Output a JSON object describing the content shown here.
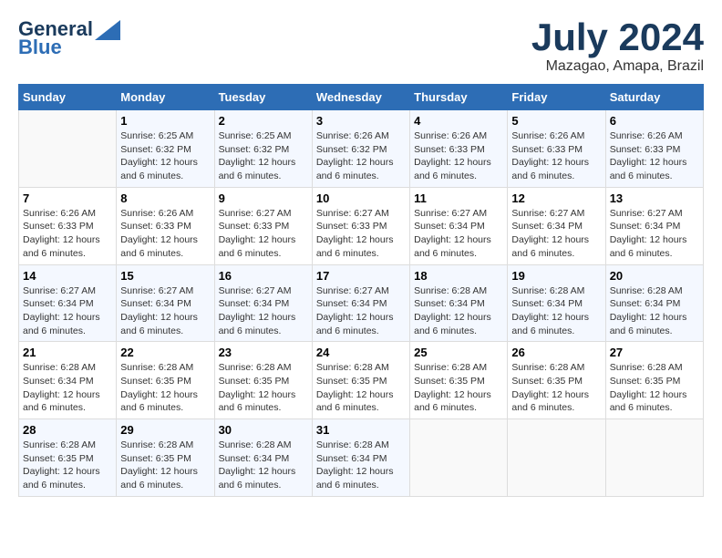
{
  "header": {
    "logo_line1": "General",
    "logo_line2": "Blue",
    "month": "July 2024",
    "location": "Mazagao, Amapa, Brazil"
  },
  "days_of_week": [
    "Sunday",
    "Monday",
    "Tuesday",
    "Wednesday",
    "Thursday",
    "Friday",
    "Saturday"
  ],
  "weeks": [
    [
      {
        "day": "",
        "info": ""
      },
      {
        "day": "1",
        "info": "Sunrise: 6:25 AM\nSunset: 6:32 PM\nDaylight: 12 hours\nand 6 minutes."
      },
      {
        "day": "2",
        "info": "Sunrise: 6:25 AM\nSunset: 6:32 PM\nDaylight: 12 hours\nand 6 minutes."
      },
      {
        "day": "3",
        "info": "Sunrise: 6:26 AM\nSunset: 6:32 PM\nDaylight: 12 hours\nand 6 minutes."
      },
      {
        "day": "4",
        "info": "Sunrise: 6:26 AM\nSunset: 6:33 PM\nDaylight: 12 hours\nand 6 minutes."
      },
      {
        "day": "5",
        "info": "Sunrise: 6:26 AM\nSunset: 6:33 PM\nDaylight: 12 hours\nand 6 minutes."
      },
      {
        "day": "6",
        "info": "Sunrise: 6:26 AM\nSunset: 6:33 PM\nDaylight: 12 hours\nand 6 minutes."
      }
    ],
    [
      {
        "day": "7",
        "info": "Sunrise: 6:26 AM\nSunset: 6:33 PM\nDaylight: 12 hours\nand 6 minutes."
      },
      {
        "day": "8",
        "info": "Sunrise: 6:26 AM\nSunset: 6:33 PM\nDaylight: 12 hours\nand 6 minutes."
      },
      {
        "day": "9",
        "info": "Sunrise: 6:27 AM\nSunset: 6:33 PM\nDaylight: 12 hours\nand 6 minutes."
      },
      {
        "day": "10",
        "info": "Sunrise: 6:27 AM\nSunset: 6:33 PM\nDaylight: 12 hours\nand 6 minutes."
      },
      {
        "day": "11",
        "info": "Sunrise: 6:27 AM\nSunset: 6:34 PM\nDaylight: 12 hours\nand 6 minutes."
      },
      {
        "day": "12",
        "info": "Sunrise: 6:27 AM\nSunset: 6:34 PM\nDaylight: 12 hours\nand 6 minutes."
      },
      {
        "day": "13",
        "info": "Sunrise: 6:27 AM\nSunset: 6:34 PM\nDaylight: 12 hours\nand 6 minutes."
      }
    ],
    [
      {
        "day": "14",
        "info": "Sunrise: 6:27 AM\nSunset: 6:34 PM\nDaylight: 12 hours\nand 6 minutes."
      },
      {
        "day": "15",
        "info": "Sunrise: 6:27 AM\nSunset: 6:34 PM\nDaylight: 12 hours\nand 6 minutes."
      },
      {
        "day": "16",
        "info": "Sunrise: 6:27 AM\nSunset: 6:34 PM\nDaylight: 12 hours\nand 6 minutes."
      },
      {
        "day": "17",
        "info": "Sunrise: 6:27 AM\nSunset: 6:34 PM\nDaylight: 12 hours\nand 6 minutes."
      },
      {
        "day": "18",
        "info": "Sunrise: 6:28 AM\nSunset: 6:34 PM\nDaylight: 12 hours\nand 6 minutes."
      },
      {
        "day": "19",
        "info": "Sunrise: 6:28 AM\nSunset: 6:34 PM\nDaylight: 12 hours\nand 6 minutes."
      },
      {
        "day": "20",
        "info": "Sunrise: 6:28 AM\nSunset: 6:34 PM\nDaylight: 12 hours\nand 6 minutes."
      }
    ],
    [
      {
        "day": "21",
        "info": "Sunrise: 6:28 AM\nSunset: 6:34 PM\nDaylight: 12 hours\nand 6 minutes."
      },
      {
        "day": "22",
        "info": "Sunrise: 6:28 AM\nSunset: 6:35 PM\nDaylight: 12 hours\nand 6 minutes."
      },
      {
        "day": "23",
        "info": "Sunrise: 6:28 AM\nSunset: 6:35 PM\nDaylight: 12 hours\nand 6 minutes."
      },
      {
        "day": "24",
        "info": "Sunrise: 6:28 AM\nSunset: 6:35 PM\nDaylight: 12 hours\nand 6 minutes."
      },
      {
        "day": "25",
        "info": "Sunrise: 6:28 AM\nSunset: 6:35 PM\nDaylight: 12 hours\nand 6 minutes."
      },
      {
        "day": "26",
        "info": "Sunrise: 6:28 AM\nSunset: 6:35 PM\nDaylight: 12 hours\nand 6 minutes."
      },
      {
        "day": "27",
        "info": "Sunrise: 6:28 AM\nSunset: 6:35 PM\nDaylight: 12 hours\nand 6 minutes."
      }
    ],
    [
      {
        "day": "28",
        "info": "Sunrise: 6:28 AM\nSunset: 6:35 PM\nDaylight: 12 hours\nand 6 minutes."
      },
      {
        "day": "29",
        "info": "Sunrise: 6:28 AM\nSunset: 6:35 PM\nDaylight: 12 hours\nand 6 minutes."
      },
      {
        "day": "30",
        "info": "Sunrise: 6:28 AM\nSunset: 6:34 PM\nDaylight: 12 hours\nand 6 minutes."
      },
      {
        "day": "31",
        "info": "Sunrise: 6:28 AM\nSunset: 6:34 PM\nDaylight: 12 hours\nand 6 minutes."
      },
      {
        "day": "",
        "info": ""
      },
      {
        "day": "",
        "info": ""
      },
      {
        "day": "",
        "info": ""
      }
    ]
  ]
}
